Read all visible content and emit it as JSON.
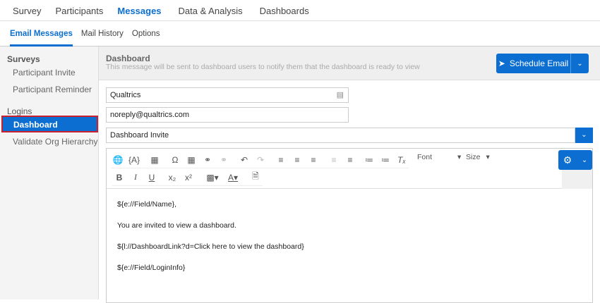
{
  "top_nav": {
    "tabs": [
      {
        "label": "Survey"
      },
      {
        "label": "Participants"
      },
      {
        "label": "Messages"
      },
      {
        "label": "Data & Analysis"
      },
      {
        "label": "Dashboards"
      }
    ],
    "active": "Messages"
  },
  "sub_nav": {
    "tabs": [
      {
        "label": "Email Messages"
      },
      {
        "label": "Mail History"
      },
      {
        "label": "Options"
      }
    ],
    "active": "Email Messages"
  },
  "sidebar": {
    "sections": [
      {
        "heading": "Surveys",
        "items": [
          "Participant Invite",
          "Participant Reminder"
        ]
      },
      {
        "heading": "Logins",
        "items": [
          "Dashboard",
          "Validate Org Hierarchy"
        ]
      }
    ],
    "selected": "Dashboard"
  },
  "header": {
    "title": "Dashboard",
    "subtitle": "This message will be sent to dashboard users to notify them that the dashboard is ready to view",
    "schedule_label": "Schedule Email"
  },
  "form": {
    "from_name": "Qualtrics",
    "from_email": "noreply@qualtrics.com",
    "subject": "Dashboard Invite"
  },
  "toolbar": {
    "font_label": "Font",
    "size_label": "Size"
  },
  "editor_body": [
    "${e://Field/Name},",
    "You are invited to view a dashboard.",
    "${l://DashboardLink?d=Click here to view the dashboard}",
    "${e://Field/LoginInfo}"
  ],
  "colors": {
    "accent": "#0b6ed0",
    "highlight_border": "#c8202f"
  }
}
